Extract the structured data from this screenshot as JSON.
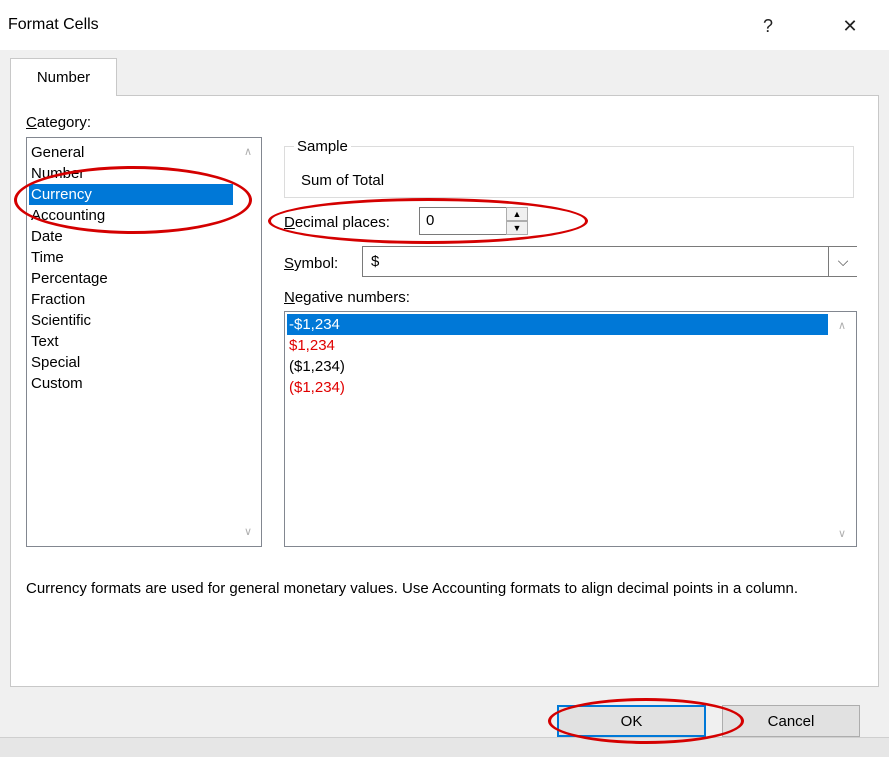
{
  "window": {
    "title": "Format Cells",
    "help_glyph": "?",
    "close_glyph": "✕"
  },
  "tabs": [
    {
      "label": "Number"
    }
  ],
  "category": {
    "label_prefix": "C",
    "label_rest": "ategory:",
    "items": [
      "General",
      "Number",
      "Currency",
      "Accounting",
      "Date",
      "Time",
      "Percentage",
      "Fraction",
      "Scientific",
      "Text",
      "Special",
      "Custom"
    ],
    "selected": "Currency"
  },
  "sample": {
    "legend": "Sample",
    "value": "Sum of Total"
  },
  "decimal_places": {
    "label_prefix": "D",
    "label_rest": "ecimal places:",
    "value": "0"
  },
  "symbol": {
    "label_prefix": "S",
    "label_rest": "ymbol:",
    "value": "$"
  },
  "negative_numbers": {
    "label_prefix": "N",
    "label_rest": "egative numbers:",
    "items": [
      {
        "text": "-$1,234",
        "color": "#000000"
      },
      {
        "text": "$1,234",
        "color": "#e00000"
      },
      {
        "text": "($1,234)",
        "color": "#000000"
      },
      {
        "text": "($1,234)",
        "color": "#e00000"
      }
    ],
    "selected_index": 0
  },
  "description": "Currency formats are used for general monetary values.  Use Accounting formats to align decimal points in a column.",
  "buttons": {
    "ok": "OK",
    "cancel": "Cancel"
  },
  "icons": {
    "up_arrow": "∧",
    "down_arrow": "∨",
    "spin_up": "▲",
    "spin_down": "▼",
    "dropdown": "⌵"
  },
  "colors": {
    "selection": "#0078d7",
    "annotation": "#d40000",
    "negative_red": "#e00000"
  }
}
